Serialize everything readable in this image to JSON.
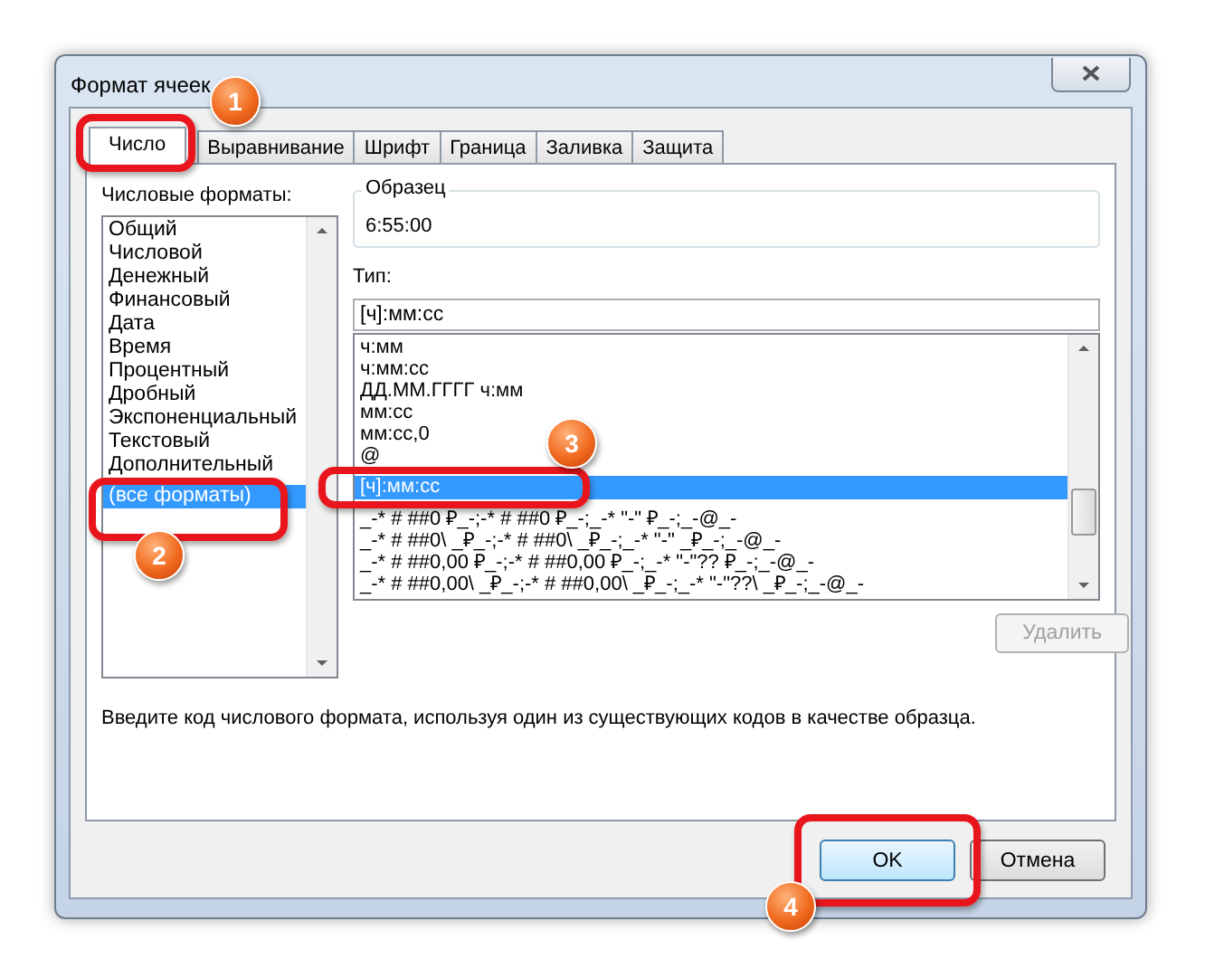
{
  "window": {
    "title": "Формат ячеек"
  },
  "tabs": [
    {
      "label": "Число",
      "selected": true
    },
    {
      "label": "Выравнивание",
      "selected": false
    },
    {
      "label": "Шрифт",
      "selected": false
    },
    {
      "label": "Граница",
      "selected": false
    },
    {
      "label": "Заливка",
      "selected": false
    },
    {
      "label": "Защита",
      "selected": false
    }
  ],
  "category_label": "Числовые форматы:",
  "categories": [
    {
      "label": "Общий",
      "selected": false
    },
    {
      "label": "Числовой",
      "selected": false
    },
    {
      "label": "Денежный",
      "selected": false
    },
    {
      "label": "Финансовый",
      "selected": false
    },
    {
      "label": "Дата",
      "selected": false
    },
    {
      "label": "Время",
      "selected": false
    },
    {
      "label": "Процентный",
      "selected": false
    },
    {
      "label": "Дробный",
      "selected": false
    },
    {
      "label": "Экспоненциальный",
      "selected": false
    },
    {
      "label": "Текстовый",
      "selected": false
    },
    {
      "label": "Дополнительный",
      "selected": false
    },
    {
      "label": "(все форматы)",
      "selected": true
    }
  ],
  "sample": {
    "label": "Образец",
    "value": "6:55:00"
  },
  "type": {
    "label": "Тип:",
    "value": "[ч]:мм:сс"
  },
  "type_list": [
    {
      "label": "ч:мм",
      "selected": false
    },
    {
      "label": "ч:мм:сс",
      "selected": false
    },
    {
      "label": "ДД.ММ.ГГГГ ч:мм",
      "selected": false
    },
    {
      "label": "мм:сс",
      "selected": false
    },
    {
      "label": "мм:сс,0",
      "selected": false
    },
    {
      "label": "@",
      "selected": false
    },
    {
      "label": "[ч]:мм:сс",
      "selected": true
    },
    {
      "label": "_-* # ##0 ₽_-;-* # ##0 ₽_-;_-* \"-\" ₽_-;_-@_-",
      "selected": false
    },
    {
      "label": "_-* # ##0\\ _₽_-;-* # ##0\\ _₽_-;_-* \"-\" _₽_-;_-@_-",
      "selected": false
    },
    {
      "label": "_-* # ##0,00 ₽_-;-* # ##0,00 ₽_-;_-* \"-\"?? ₽_-;_-@_-",
      "selected": false
    },
    {
      "label": "_-* # ##0,00\\ _₽_-;-* # ##0,00\\ _₽_-;_-* \"-\"??\\ _₽_-;_-@_-",
      "selected": false
    }
  ],
  "delete_button": {
    "label": "Удалить",
    "disabled": true
  },
  "hint": "Введите код числового формата, используя один из существующих кодов в качестве образца.",
  "buttons": [
    {
      "label": "OK"
    },
    {
      "label": "Отмена"
    }
  ],
  "annotations": [
    {
      "number": "1"
    },
    {
      "number": "2"
    },
    {
      "number": "3"
    },
    {
      "number": "4"
    }
  ]
}
